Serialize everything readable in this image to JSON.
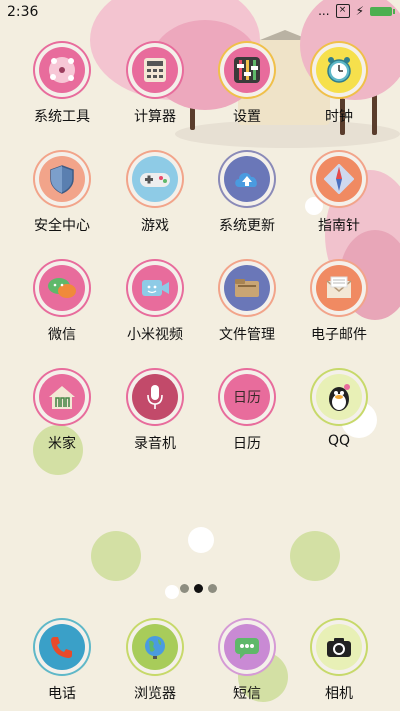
{
  "status": {
    "time": "2:36",
    "dots": "...",
    "sim": "×"
  },
  "pages": {
    "count": 3,
    "active": 1
  },
  "apps": [
    {
      "name": "系统工具"
    },
    {
      "name": "计算器"
    },
    {
      "name": "设置"
    },
    {
      "name": "时钟"
    },
    {
      "name": "安全中心"
    },
    {
      "name": "游戏"
    },
    {
      "name": "系统更新"
    },
    {
      "name": "指南针"
    },
    {
      "name": "微信"
    },
    {
      "name": "小米视频"
    },
    {
      "name": "文件管理"
    },
    {
      "name": "电子邮件"
    },
    {
      "name": "米家"
    },
    {
      "name": "录音机"
    },
    {
      "name": "日历",
      "icon_text": "日历"
    },
    {
      "name": "QQ"
    }
  ],
  "dock": [
    {
      "name": "电话"
    },
    {
      "name": "浏览器"
    },
    {
      "name": "短信"
    },
    {
      "name": "相机"
    }
  ],
  "colors": {
    "pink": "#e86c9c",
    "green_deco": "#cbdc95",
    "background": "#f3eee0"
  }
}
